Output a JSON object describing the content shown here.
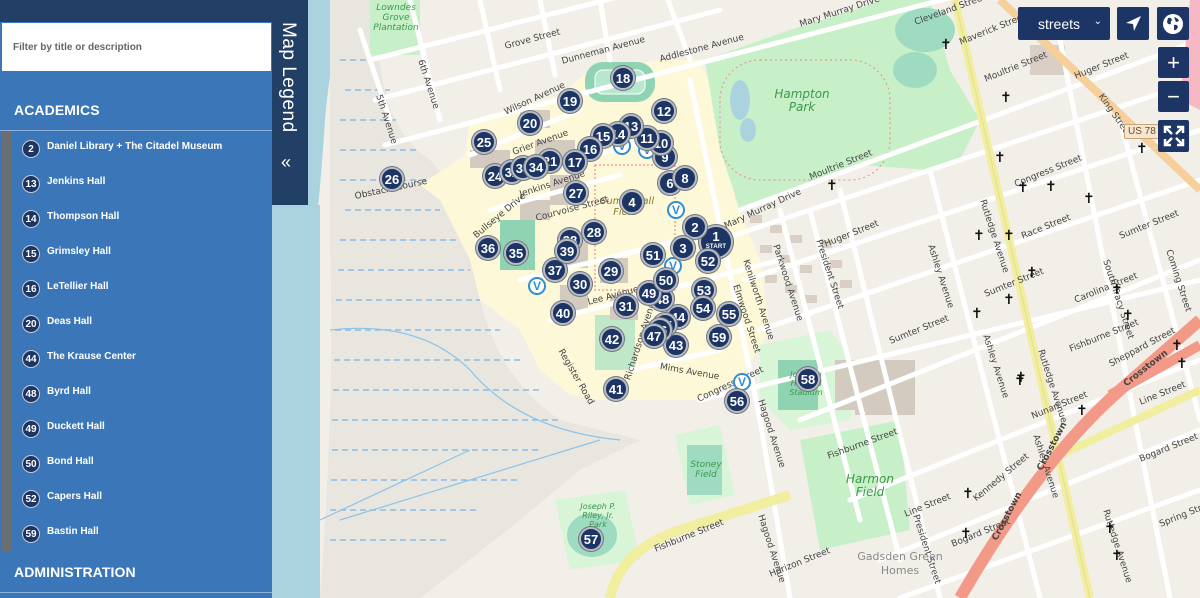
{
  "sidebar": {
    "filter_placeholder": "Filter by title or description",
    "categories": [
      {
        "heading": "ACADEMICS",
        "items": [
          {
            "num": "2",
            "label": "Daniel Library + The Citadel Museum"
          },
          {
            "num": "13",
            "label": "Jenkins Hall"
          },
          {
            "num": "14",
            "label": "Thompson Hall"
          },
          {
            "num": "15",
            "label": "Grimsley Hall"
          },
          {
            "num": "16",
            "label": "LeTellier Hall"
          },
          {
            "num": "20",
            "label": "Deas Hall"
          },
          {
            "num": "44",
            "label": "The Krause Center"
          },
          {
            "num": "48",
            "label": "Byrd Hall"
          },
          {
            "num": "49",
            "label": "Duckett Hall"
          },
          {
            "num": "50",
            "label": "Bond Hall"
          },
          {
            "num": "52",
            "label": "Capers Hall"
          },
          {
            "num": "59",
            "label": "Bastin Hall"
          }
        ]
      },
      {
        "heading": "ADMINISTRATION",
        "items": []
      }
    ]
  },
  "legend_tab": {
    "title": "Map Legend",
    "collapse_icon": "«"
  },
  "controls": {
    "style_select_value": "streets",
    "zoom_in": "+",
    "zoom_out": "−"
  },
  "map": {
    "markers": [
      "1",
      "2",
      "3",
      "4",
      "6",
      "8",
      "9",
      "10",
      "11",
      "12",
      "13",
      "14",
      "15",
      "16",
      "17",
      "18",
      "19",
      "20",
      "21",
      "24",
      "25",
      "26",
      "27",
      "28",
      "29",
      "30",
      "31",
      "32",
      "33",
      "34",
      "35",
      "36",
      "37",
      "38",
      "39",
      "40",
      "41",
      "42",
      "43",
      "44",
      "45",
      "46",
      "47",
      "48",
      "49",
      "50",
      "51",
      "52",
      "53",
      "54",
      "55",
      "56",
      "57",
      "58",
      "59"
    ],
    "start_label": "START",
    "visitor_marker_label": "V",
    "park_labels": {
      "lowndes": "Lowndes Grove Plantation",
      "hampton": "Hampton Park",
      "summerall": "Summerall Field",
      "stoney": "Stoney Field",
      "harmon": "Harmon Field",
      "riley": "Joseph P. Riley, Jr. Park",
      "stadium": "Johnson Hagood Stadium",
      "gadsden": "Gadsden Green Homes"
    },
    "street_labels": {
      "grove": "Grove Street",
      "dunneman": "Dunneman Avenue",
      "addlestone": "Addlestone Avenue",
      "wilson": "Wilson Avenue",
      "grier": "Grier Avenue",
      "jenkins": "Jenkins Avenue",
      "courvoise": "Courvoise Street",
      "bullseye": "Bullseye Drive",
      "obstacle": "Obstacle Course",
      "lee": "Lee Avenue",
      "mims": "Mims Avenue",
      "register": "Register Road",
      "richardson": "Richardson Avenue",
      "congress": "Congress Street",
      "hagood": "Hagood Avenue",
      "fishburne": "Fishburne Street",
      "horizon": "Horizon Street",
      "marymurray": "Mary Murray Drive",
      "cleveland": "Cleveland Street",
      "maverick": "Maverick Street",
      "moultrie": "Moultrie Street",
      "huger": "Huger Street",
      "king": "King Street",
      "rutledge": "Rutledge Avenue",
      "ashley": "Ashley Avenue",
      "sumter": "Sumter Street",
      "elmwood": "Elmwood Street",
      "kenilworth": "Kenilworth Avenue",
      "parkwood": "Parkwood Avenue",
      "president": "President Street",
      "congress2": "Congress Street",
      "race": "Race Street",
      "carolina": "Carolina Street",
      "tracy": "South Tracy Street",
      "coming": "Coming Street",
      "sheppard": "Sheppard Street",
      "crosstown": "Crosstown",
      "line": "Line Street",
      "nunan": "Nunan Street",
      "bogard": "Bogard Street",
      "kennedy": "Kennedy Street",
      "spring": "Spring Street",
      "fifth": "5th Avenue",
      "sixth": "6th Avenue",
      "us78": "US 78"
    }
  }
}
